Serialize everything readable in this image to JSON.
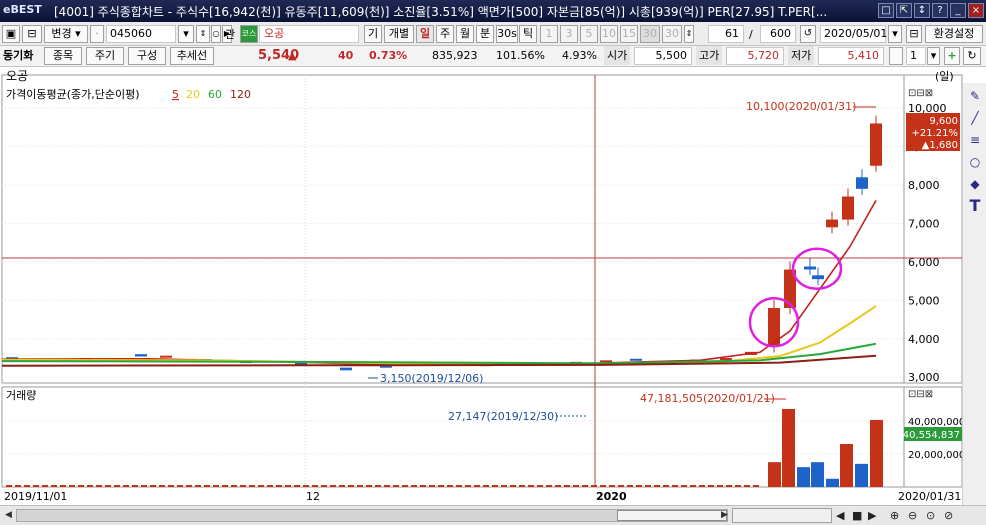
{
  "titlebar": {
    "logo": "eBEST",
    "title": "[4001] 주식종합차트 - 주식수[16,942(천)] 유동주[11,609(천)] 소진율[3.51%] 액면가[500] 자본금[85(억)] 시총[939(억)] PER[27.95] T.PER[..."
  },
  "toolbar1": {
    "change_label": "변경",
    "stock_code": "045060",
    "gwan_label": "관",
    "stock_name": "오공",
    "gi_label": "기",
    "gaebyeol_label": "개별",
    "period_tabs": [
      "일",
      "주",
      "월",
      "분",
      "30s",
      "틱"
    ],
    "active_period": "일",
    "num_buttons": [
      "1",
      "3",
      "5",
      "10",
      "15",
      "30",
      "30"
    ],
    "count_value": "61",
    "slash": "/",
    "total_value": "600",
    "date_value": "2020/05/01",
    "env_label": "환경설정"
  },
  "toolbar2": {
    "sync_label": "동기화",
    "item_label": "종목",
    "period_label": "주기",
    "compose_label": "구성",
    "trend_label": "추세선",
    "price": "5,540",
    "up_arrow": "▲",
    "change": "40",
    "change_pct": "0.73%",
    "volume": "835,923",
    "vol_ratio": "101.56%",
    "pct2": "4.93%",
    "open_label": "시가",
    "open_value": "5,500",
    "high_label": "고가",
    "high_value": "5,720",
    "low_label": "저가",
    "low_value": "5,410",
    "select_value": "1"
  },
  "chart": {
    "stock_title": "오공",
    "period_tag": "(일)",
    "ma_title": "가격이동평균(종가,단순이평)",
    "ma_periods": [
      "5",
      "20",
      "60",
      "120"
    ],
    "volume_title": "거래량",
    "high_annotation": "10,100(2020/01/31)",
    "low_annotation": "3,150(2019/12/06)",
    "vol_annotation": "47,181,505(2020/01/21)",
    "vol_annotation2": "27,147(2019/12/30)",
    "last_price_box": [
      "9,600",
      "+21.21%",
      "▲1,680"
    ],
    "vol_last_box": "40,554,837",
    "x_labels": [
      "2019/11/01",
      "12",
      "2020",
      "2020/01/31"
    ],
    "price_axis": [
      "10,000",
      "9,000",
      "8,000",
      "7,000",
      "6,000",
      "5,000",
      "4,000",
      "3,000"
    ],
    "vol_axis": [
      "40,000,000",
      "20,000,000"
    ],
    "colors": {
      "up": "#c43218",
      "down": "#1e64c8",
      "ma5": "#c41e1e",
      "ma20": "#e8c81a",
      "ma60": "#28a83c",
      "ma120": "#8c1e14",
      "highlight": "#e020e0"
    }
  },
  "chart_data": {
    "type": "candlestick",
    "title": "오공",
    "x_range": [
      "2019/11/01",
      "2020/01/31"
    ],
    "price_ylim": [
      3000,
      10100
    ],
    "price_series": [
      {
        "date": "2019/11 early",
        "price": 3500
      },
      {
        "date": "2019/11 mid",
        "price": 3450
      },
      {
        "date": "2019/12/06",
        "price": 3150
      },
      {
        "date": "2019/12/30",
        "price": 3350
      },
      {
        "date": "2020/01 mid",
        "price": 3600
      },
      {
        "date": "2020/01/16",
        "price": 4800
      },
      {
        "date": "2020/01/20",
        "price": 5800
      },
      {
        "date": "2020/01/21",
        "price": 5600
      },
      {
        "date": "2020/01/24",
        "price": 7000
      },
      {
        "date": "2020/01/28",
        "price": 7500
      },
      {
        "date": "2020/01/29",
        "price": 8100
      },
      {
        "date": "2020/01/31",
        "price": 9600
      }
    ],
    "volume_series": [
      {
        "date": "2020/01/16",
        "volume": 15000000
      },
      {
        "date": "2020/01/21",
        "volume": 47181505
      },
      {
        "date": "2020/01/22",
        "volume": 12000000
      },
      {
        "date": "2020/01/23",
        "volume": 15000000
      },
      {
        "date": "2020/01/28",
        "volume": 5000000
      },
      {
        "date": "2020/01/29",
        "volume": 26000000
      },
      {
        "date": "2020/01/30",
        "volume": 14000000
      },
      {
        "date": "2020/01/31",
        "volume": 40554837
      }
    ]
  },
  "scroll": {
    "prev": "◀",
    "next": "▶"
  }
}
